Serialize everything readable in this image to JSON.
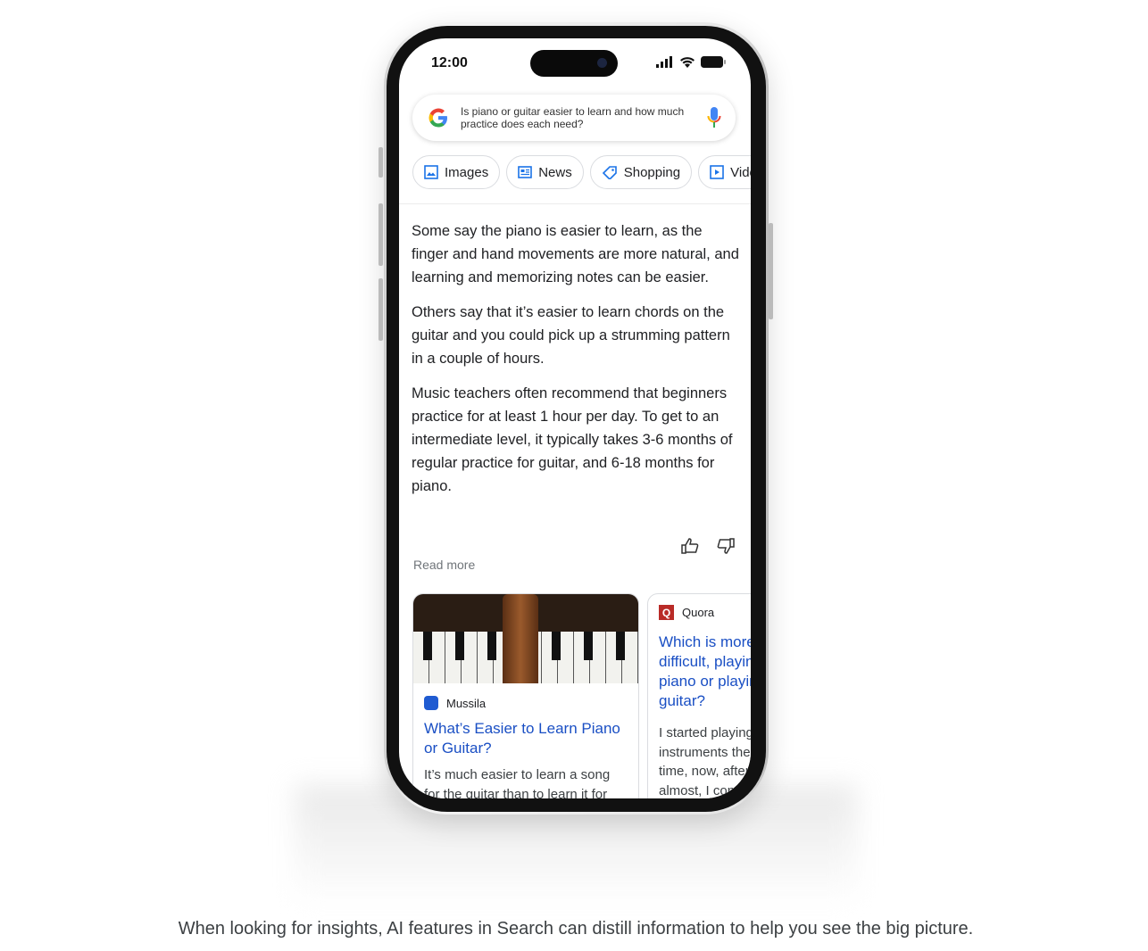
{
  "status_bar": {
    "time": "12:00"
  },
  "search": {
    "query": "Is piano or guitar easier to learn and how much practice does each need?",
    "icon": "google-logo",
    "mic_icon": "mic-icon"
  },
  "chips": [
    {
      "label": "Images",
      "icon": "image-icon"
    },
    {
      "label": "News",
      "icon": "news-icon"
    },
    {
      "label": "Shopping",
      "icon": "tag-icon"
    },
    {
      "label": "Videos",
      "icon": "play-icon"
    }
  ],
  "answer": {
    "paragraphs": [
      "Some say the piano is easier to learn, as the finger and hand movements are more natural, and learning and memorizing notes can be easier.",
      "Others say that it’s easier to learn chords on the guitar and you could pick up a strumming pattern in a couple of hours.",
      "Music teachers often recommend that beginners practice for at least 1 hour per day. To get to an intermediate level, it typically takes 3-6 months of regular practice for guitar, and 6-18 months for piano."
    ],
    "read_more": "Read more"
  },
  "cards": [
    {
      "source": "Mussila",
      "title": "What’s Easier to Learn Piano or Guitar?",
      "snippet": "It’s much easier to learn a song for the guitar than to learn it for"
    },
    {
      "source": "Quora",
      "title": "Which is more difficult, playing piano or playing guitar?",
      "snippet": "I started playing both instruments the same time, now, after almost, I continue to develop proficient"
    }
  ],
  "caption": "When looking for insights, AI features in Search can distill information to help you see the big picture.",
  "colors": {
    "link": "#1a4fc4",
    "chip_icon": "#1a73e8",
    "quora": "#b92b27"
  }
}
